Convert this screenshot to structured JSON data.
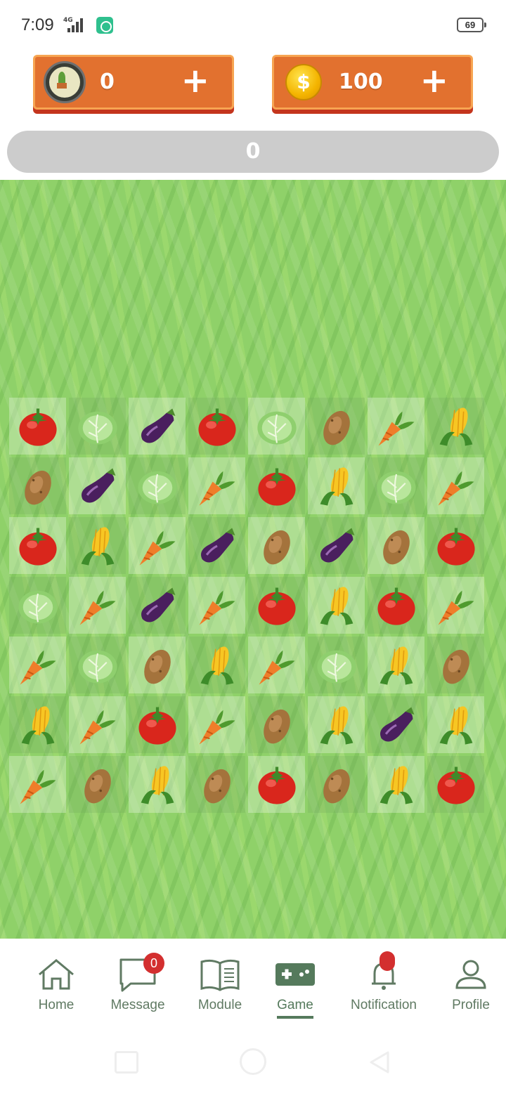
{
  "status_bar": {
    "time": "7:09",
    "network": "4G",
    "battery": "69"
  },
  "currencies": {
    "avatar_count": "0",
    "coin_count": "100",
    "plus_label": "+"
  },
  "progress": {
    "value": "0"
  },
  "board": {
    "rows": 7,
    "cols": 8,
    "tiles": [
      [
        "tomato",
        "cabbage",
        "eggplant",
        "tomato",
        "cabbage",
        "potato",
        "carrot",
        "corn"
      ],
      [
        "potato",
        "eggplant",
        "cabbage",
        "carrot",
        "tomato",
        "corn",
        "cabbage",
        "carrot"
      ],
      [
        "tomato",
        "corn",
        "carrot",
        "eggplant",
        "potato",
        "eggplant",
        "potato",
        "tomato"
      ],
      [
        "cabbage",
        "carrot",
        "eggplant",
        "carrot",
        "tomato",
        "corn",
        "tomato",
        "carrot"
      ],
      [
        "carrot",
        "cabbage",
        "potato",
        "corn",
        "carrot",
        "cabbage",
        "corn",
        "potato"
      ],
      [
        "corn",
        "carrot",
        "tomato",
        "carrot",
        "potato",
        "corn",
        "eggplant",
        "corn"
      ],
      [
        "carrot",
        "potato",
        "corn",
        "potato",
        "tomato",
        "potato",
        "corn",
        "tomato"
      ]
    ]
  },
  "nav": {
    "items": [
      {
        "label": "Home",
        "icon": "home-icon"
      },
      {
        "label": "Message",
        "icon": "message-icon",
        "badge": "0"
      },
      {
        "label": "Module",
        "icon": "book-icon"
      },
      {
        "label": "Game",
        "icon": "gamepad-icon",
        "active": true
      },
      {
        "label": "Notification",
        "icon": "bell-icon"
      },
      {
        "label": "Profile",
        "icon": "person-icon"
      }
    ]
  },
  "colors": {
    "panel_orange": "#e2712f",
    "nav_green": "#607a63",
    "badge_red": "#d32f2f",
    "grass": "#8fd169"
  }
}
